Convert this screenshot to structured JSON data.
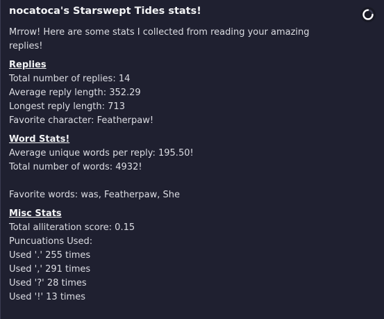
{
  "embed": {
    "title": "nocatoca's Starswept Tides stats!",
    "intro": "Mrrow! Here are some stats I collected from reading your amazing replies!",
    "loading_icon": "loading-spinner-icon"
  },
  "replies": {
    "heading": "Replies",
    "total": "Total number of replies: 14",
    "average_length": "Average reply length: 352.29",
    "longest_length": "Longest reply length: 713",
    "favorite_character": "Favorite character: Featherpaw!"
  },
  "word_stats": {
    "heading": "Word Stats!",
    "average_unique": "Average unique words per reply: 195.50!",
    "total_words": "Total number of words: 4932!",
    "favorite_words": "Favorite words: was, Featherpaw, She"
  },
  "misc_stats": {
    "heading": "Misc Stats",
    "alliteration": "Total alliteration score: 0.15",
    "punctuation_label": "Puncuations Used:",
    "punctuation": [
      "Used '.' 255 times",
      "Used ',' 291 times",
      "Used '?' 28 times",
      "Used '!' 13 times"
    ]
  },
  "colors": {
    "background": "#1f2030",
    "text": "#dcdde3",
    "heading": "#f2f3f5"
  }
}
